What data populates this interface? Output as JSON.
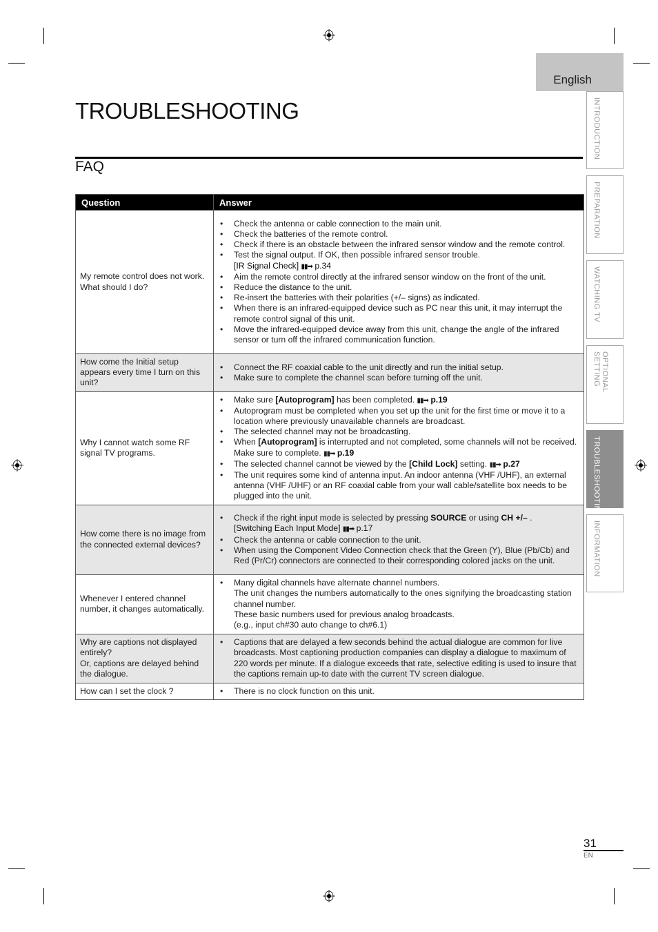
{
  "header": {
    "language_tab": "English"
  },
  "side_tabs": [
    {
      "label": "INTRODUCTION",
      "active": false
    },
    {
      "label": "PREPARATION",
      "active": false
    },
    {
      "label": "WATCHING TV",
      "active": false
    },
    {
      "label": "OPTIONAL SETTING",
      "active": false
    },
    {
      "label": "TROUBLESHOOTING",
      "active": true
    },
    {
      "label": "INFORMATION",
      "active": false
    }
  ],
  "page": {
    "title": "TROUBLESHOOTING",
    "section": "FAQ",
    "number": "31",
    "lang_code": "EN"
  },
  "faq": {
    "headers": {
      "question": "Question",
      "answer": "Answer"
    },
    "rows": [
      {
        "question": [
          "My remote control does not work.",
          "What should I do?"
        ],
        "answers": [
          {
            "text": "Check the antenna or cable connection to the main unit."
          },
          {
            "text": "Check the batteries of the remote control."
          },
          {
            "text": "Check if there is an obstacle between the infrared sensor window and the remote control."
          },
          {
            "text": "Test the signal output. If OK, then possible infrared sensor trouble.",
            "ref_label": "[IR Signal Check]",
            "ref_page": "p.34"
          },
          {
            "text": "Aim the remote control directly at the infrared sensor window on the front of the unit."
          },
          {
            "text": "Reduce the distance to the unit."
          },
          {
            "text": "Re-insert the batteries with their polarities (+/– signs) as indicated."
          },
          {
            "text": "When there is an infrared-equipped device such as PC near this unit, it may interrupt the remote control signal of this unit."
          },
          {
            "text": "Move the infrared-equipped device away from this unit, change the angle of the infrared sensor or turn off the infrared communication function."
          }
        ]
      },
      {
        "question": [
          "How come the Initial setup appears every time I turn on this unit?"
        ],
        "answers": [
          {
            "text": "Connect the RF coaxial cable to the unit directly and run the initial setup."
          },
          {
            "text": "Make sure to complete the channel scan before turning off the unit."
          }
        ]
      },
      {
        "question": [
          "Why I cannot watch some RF signal TV programs."
        ],
        "answers": [
          {
            "pre": "Make sure ",
            "bold": "[Autoprogram]",
            "post": " has been completed.",
            "ref_page": "p.19"
          },
          {
            "text": "Autoprogram must be completed when you set up the unit for the first time or move it to a location where previously unavailable channels are broadcast."
          },
          {
            "text": "The selected channel may not be broadcasting."
          },
          {
            "pre": "When ",
            "bold": "[Autoprogram]",
            "post": " is interrupted and not completed, some channels will not be received. Make sure to complete.",
            "ref_page": "p.19"
          },
          {
            "pre": "The selected channel cannot be viewed by the ",
            "bold": "[Child Lock]",
            "post": " setting.",
            "ref_page": "p.27"
          },
          {
            "text": "The unit requires some kind of antenna input. An indoor antenna (VHF /UHF), an external antenna (VHF /UHF) or an RF coaxial cable from your wall cable/satellite box needs to be plugged into the unit."
          }
        ]
      },
      {
        "question": [
          "How come there is no image from the connected external devices?"
        ],
        "answers": [
          {
            "pre": "Check if the right input mode is selected by pressing ",
            "bold": "SOURCE",
            "mid": " or using ",
            "bold2": "CH +/–",
            "post": " .",
            "ref_label": "[Switching Each Input Mode]",
            "ref_page": "p.17"
          },
          {
            "text": "Check the antenna or cable connection to the unit."
          },
          {
            "text": "When using the Component Video Connection check that the Green (Y), Blue (Pb/Cb) and Red (Pr/Cr) connectors are connected to their corresponding colored jacks on the unit."
          }
        ]
      },
      {
        "question": [
          "Whenever I entered channel number, it changes automatically."
        ],
        "answers": [
          {
            "text": "Many digital channels have alternate channel numbers.",
            "extra": [
              "The unit changes the numbers automatically to the ones signifying the broadcasting station channel number.",
              "These basic numbers used for previous analog broadcasts.",
              "(e.g., input ch#30 auto change to ch#6.1)"
            ]
          }
        ]
      },
      {
        "question": [
          "Why are captions not displayed entirely?",
          "Or, captions are delayed behind the dialogue."
        ],
        "answers": [
          {
            "text": "Captions that are delayed a few seconds behind the actual dialogue are common for live broadcasts. Most captioning production companies can display a dialogue to maximum of 220 words per minute. If a dialogue exceeds that rate, selective editing is used to insure that the captions remain up-to date with the current TV screen dialogue."
          }
        ]
      },
      {
        "question": [
          "How can I set the clock ?"
        ],
        "answers": [
          {
            "text": "There is no clock function on this unit."
          }
        ]
      }
    ]
  },
  "icons": {
    "bullet": "•",
    "page_ref_arrow": "▮▮➡"
  }
}
